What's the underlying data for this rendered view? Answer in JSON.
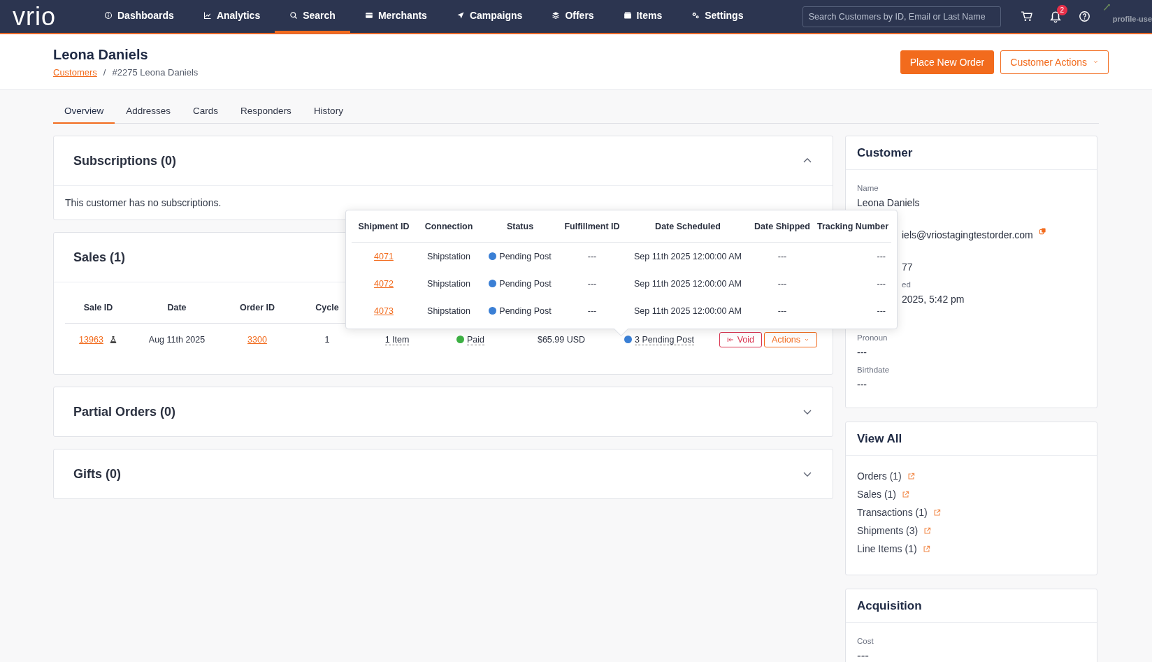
{
  "nav": {
    "logo": "vrio",
    "items": [
      {
        "label": "Dashboards",
        "selected": false
      },
      {
        "label": "Analytics",
        "selected": false
      },
      {
        "label": "Search",
        "selected": true
      },
      {
        "label": "Merchants",
        "selected": false
      },
      {
        "label": "Campaigns",
        "selected": false
      },
      {
        "label": "Offers",
        "selected": false
      },
      {
        "label": "Items",
        "selected": false
      },
      {
        "label": "Settings",
        "selected": false
      }
    ],
    "search": {
      "placeholder": "Search Customers by ID, Email or Last Name"
    },
    "notifications": "2",
    "profile": "profile-use"
  },
  "header": {
    "title": "Leona Daniels",
    "breadcrumb": [
      {
        "label": "Customers",
        "kind": "link"
      },
      {
        "label": "/",
        "kind": "separator"
      },
      {
        "label": "#2275 Leona Daniels",
        "kind": "text"
      }
    ],
    "buttons": [
      {
        "label": "Place New Order",
        "kind": "primary"
      },
      {
        "label": "Customer Actions",
        "kind": "outline"
      }
    ]
  },
  "tabs": [
    {
      "label": "Overview",
      "selected": true
    },
    {
      "label": "Addresses",
      "selected": false
    },
    {
      "label": "Cards",
      "selected": false
    },
    {
      "label": "Responders",
      "selected": false
    },
    {
      "label": "History",
      "selected": false
    }
  ],
  "subscriptions": {
    "title": "Subscriptions (0)",
    "expanded": true,
    "message": "This customer has no subscriptions."
  },
  "sales": {
    "title": "Sales (1)",
    "columns": [
      "Sale ID",
      "Date",
      "Order ID",
      "Cycle"
    ],
    "rows": [
      {
        "sale_id": "13963",
        "date": "Aug 11th 2025",
        "order_id": "3300",
        "cycle": "1",
        "items": "1 Item",
        "payment": {
          "label": "Paid",
          "color": "#3cb043"
        },
        "amount": "$65.99 USD",
        "shipping": {
          "label": "3 Pending Post",
          "color": "#3a7fd5"
        },
        "buttons": [
          {
            "label": "Void",
            "kind": "danger"
          },
          {
            "label": "Actions",
            "kind": "outline"
          }
        ]
      }
    ]
  },
  "partial_orders": {
    "title": "Partial Orders (0)",
    "expanded": false
  },
  "gifts": {
    "title": "Gifts (0)",
    "expanded": false
  },
  "shipments_popover": {
    "columns": [
      "Shipment ID",
      "Connection",
      "Status",
      "Fulfillment ID",
      "Date Scheduled",
      "Date Shipped",
      "Tracking Number"
    ],
    "rows": [
      {
        "id": "4071",
        "connection": "Shipstation",
        "status": "Pending Post",
        "color": "#3a7fd5",
        "fulfillment_id": "---",
        "date_scheduled": "Sep 11th 2025 12:00:00 AM",
        "date_shipped": "---",
        "tracking": "---"
      },
      {
        "id": "4072",
        "connection": "Shipstation",
        "status": "Pending Post",
        "color": "#3a7fd5",
        "fulfillment_id": "---",
        "date_scheduled": "Sep 11th 2025 12:00:00 AM",
        "date_shipped": "---",
        "tracking": "---"
      },
      {
        "id": "4073",
        "connection": "Shipstation",
        "status": "Pending Post",
        "color": "#3a7fd5",
        "fulfillment_id": "---",
        "date_scheduled": "Sep 11th 2025 12:00:00 AM",
        "date_shipped": "---",
        "tracking": "---"
      }
    ]
  },
  "customer": {
    "title": "Customer",
    "fields": [
      {
        "label": "Name",
        "value": "Leona Daniels",
        "kind": "text"
      },
      {
        "value": "iels@vriostagingtestorder.com",
        "kind": "partial_email"
      },
      {
        "value": "77",
        "kind": "partial"
      },
      {
        "label": "ed",
        "value": "2025, 5:42 pm",
        "kind": "partial"
      },
      {
        "label": "Pronoun",
        "value": "---",
        "kind": "text"
      },
      {
        "label": "Birthdate",
        "value": "---",
        "kind": "text"
      }
    ]
  },
  "view_all": {
    "title": "View All",
    "links": [
      "Orders (1)",
      "Sales (1)",
      "Transactions (1)",
      "Shipments (3)",
      "Line Items (1)"
    ]
  },
  "acquisition": {
    "title": "Acquisition",
    "fields": [
      {
        "label": "Cost",
        "value": "---"
      }
    ]
  }
}
